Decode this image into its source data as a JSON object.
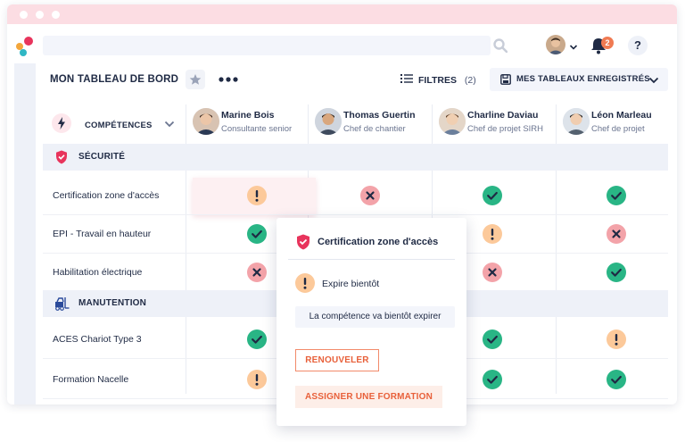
{
  "header": {
    "notifications_count": "2",
    "help_label": "?"
  },
  "toolbar": {
    "title": "MON TABLEAU DE BORD",
    "filters_label": "FILTRES",
    "filters_count": "(2)",
    "saved_boards_label": "MES TABLEAUX ENREGISTRÉS"
  },
  "grid": {
    "competences_label": "COMPÉTENCES",
    "people": [
      {
        "name": "Marine Bois",
        "role": "Consultante senior"
      },
      {
        "name": "Thomas Guertin",
        "role": "Chef de chantier"
      },
      {
        "name": "Charline Daviau",
        "role": "Chef de projet SIRH"
      },
      {
        "name": "Léon Marleau",
        "role": "Chef de projet"
      }
    ],
    "sections": [
      {
        "label": "SÉCURITÉ",
        "icon": "shield-icon",
        "rows": [
          {
            "label": "Certification zone d'accès",
            "statuses": [
              "warn",
              "ko",
              "ok",
              "ok"
            ]
          },
          {
            "label": "EPI - Travail en hauteur",
            "statuses": [
              "ok",
              "",
              "warn",
              "ko"
            ]
          },
          {
            "label": "Habilitation électrique",
            "statuses": [
              "ko",
              "",
              "ko",
              "ok"
            ]
          }
        ]
      },
      {
        "label": "MANUTENTION",
        "icon": "forklift-icon",
        "rows": [
          {
            "label": "ACES Chariot Type 3",
            "statuses": [
              "ok",
              "",
              "ok",
              "warn"
            ]
          },
          {
            "label": "Formation Nacelle",
            "statuses": [
              "warn",
              "",
              "ok",
              "ok"
            ]
          }
        ]
      }
    ]
  },
  "popup": {
    "title": "Certification zone d'accès",
    "status_label": "Expire bientôt",
    "description": "La compétence va bientôt expirer",
    "renew_label": "RENOUVELER",
    "assign_label": "ASSIGNER UNE FORMATION"
  },
  "colors": {
    "ok": "#29b585",
    "ko": "#f3a3a9",
    "warn": "#fcc99a",
    "accent": "#e8603a",
    "brand_pink": "#e8345c"
  }
}
